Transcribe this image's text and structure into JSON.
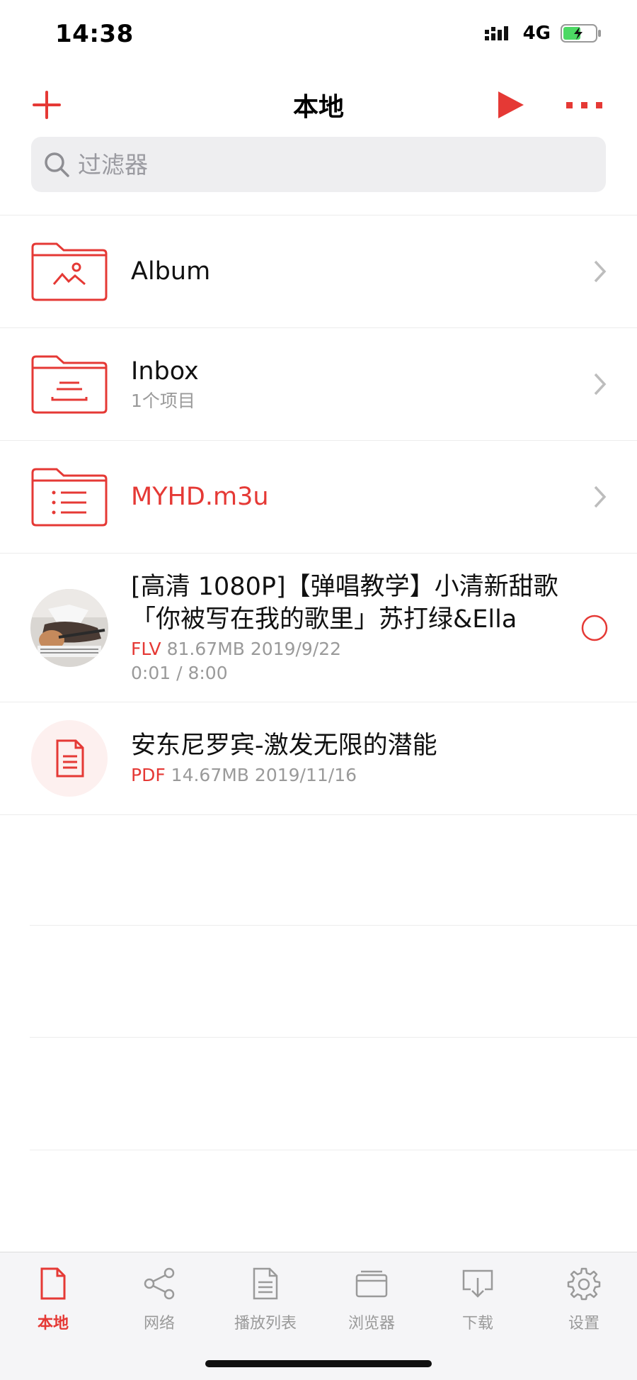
{
  "status_bar": {
    "time": "14:38",
    "network": "4G"
  },
  "nav": {
    "title": "本地"
  },
  "search": {
    "placeholder": "过滤器"
  },
  "items": [
    {
      "kind": "folder",
      "title": "Album",
      "subtitle": ""
    },
    {
      "kind": "folder",
      "title": "Inbox",
      "subtitle": "1个项目"
    },
    {
      "kind": "playlist",
      "title": "MYHD.m3u"
    },
    {
      "kind": "video",
      "title": "[高清 1080P]【弹唱教学】小清新甜歌「你被写在我的歌里」苏打绿&Ella",
      "type": "FLV",
      "size_date": "81.67MB 2019/9/22",
      "progress_text": "0:01 / 8:00"
    },
    {
      "kind": "document",
      "title": "安东尼罗宾-激发无限的潜能",
      "type": "PDF",
      "size_date": "14.67MB 2019/11/16"
    }
  ],
  "tabs": [
    {
      "label": "本地",
      "icon": "document-icon",
      "active": true
    },
    {
      "label": "网络",
      "icon": "share-icon",
      "active": false
    },
    {
      "label": "播放列表",
      "icon": "playlist-icon",
      "active": false
    },
    {
      "label": "浏览器",
      "icon": "browser-icon",
      "active": false
    },
    {
      "label": "下载",
      "icon": "download-icon",
      "active": false
    },
    {
      "label": "设置",
      "icon": "gear-icon",
      "active": false
    }
  ],
  "colors": {
    "accent": "#e53935",
    "battery_green": "#4cd964"
  }
}
